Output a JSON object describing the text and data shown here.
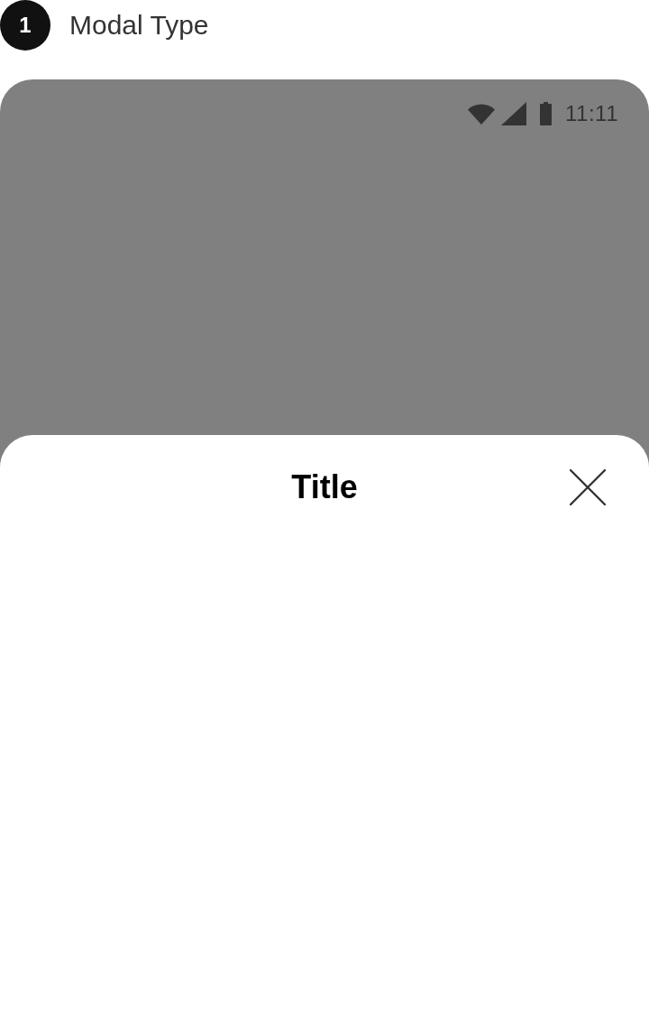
{
  "step": {
    "number": "1",
    "label": "Modal Type"
  },
  "status_bar": {
    "time": "11:11"
  },
  "sheet": {
    "title": "Title"
  }
}
